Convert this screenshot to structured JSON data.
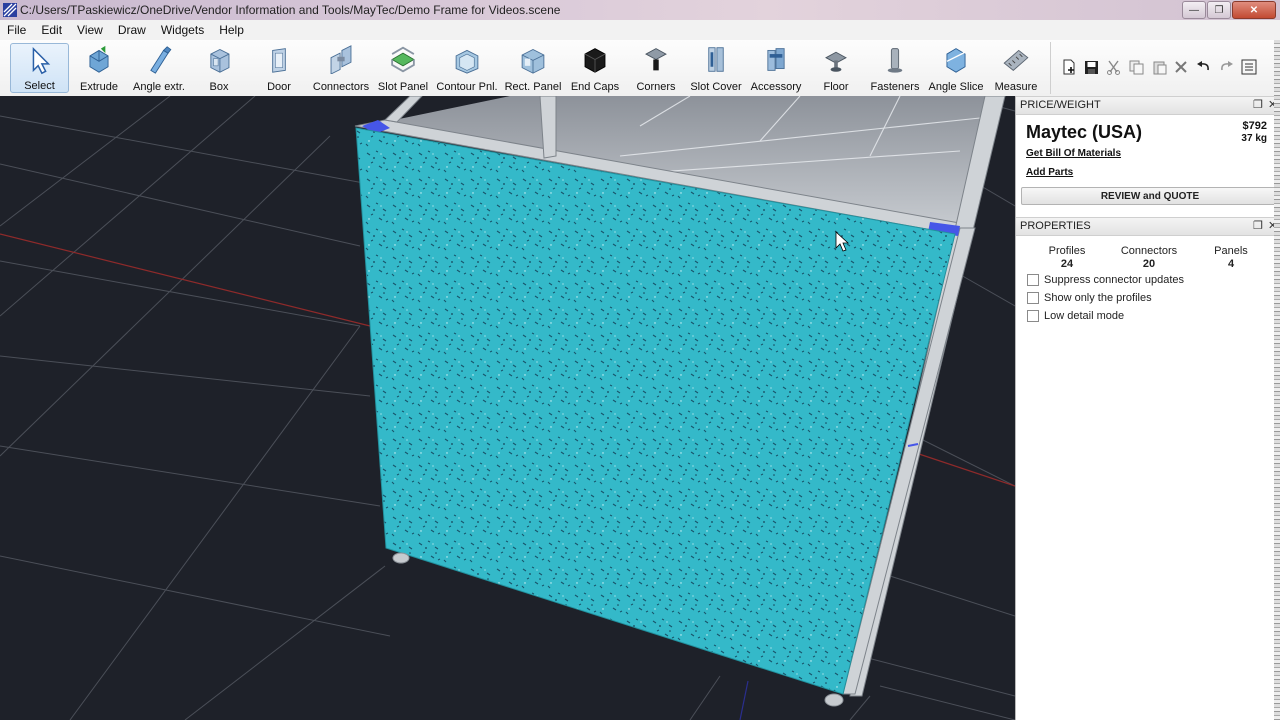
{
  "window": {
    "title": "C:/Users/TPaskiewicz/OneDrive/Vendor Information and Tools/MayTec/Demo Frame for Videos.scene",
    "controls": [
      "minimize",
      "restore",
      "close"
    ]
  },
  "menu": [
    "File",
    "Edit",
    "View",
    "Draw",
    "Widgets",
    "Help"
  ],
  "toolbar": {
    "tools": [
      {
        "label": "Select",
        "icon": "arrow-cursor-icon"
      },
      {
        "label": "Extrude",
        "icon": "extrude-icon"
      },
      {
        "label": "Angle extr.",
        "icon": "angle-extrude-icon"
      },
      {
        "label": "Box",
        "icon": "box-icon"
      },
      {
        "label": "Door",
        "icon": "door-icon"
      },
      {
        "label": "Connectors",
        "icon": "connectors-icon"
      },
      {
        "label": "Slot Panel",
        "icon": "slot-panel-icon"
      },
      {
        "label": "Contour Pnl.",
        "icon": "contour-panel-icon"
      },
      {
        "label": "Rect. Panel",
        "icon": "rect-panel-icon"
      },
      {
        "label": "End Caps",
        "icon": "end-caps-icon"
      },
      {
        "label": "Corners",
        "icon": "corners-icon"
      },
      {
        "label": "Slot Cover",
        "icon": "slot-cover-icon"
      },
      {
        "label": "Accessory",
        "icon": "accessory-icon"
      },
      {
        "label": "Floor",
        "icon": "floor-icon"
      },
      {
        "label": "Fasteners",
        "icon": "fasteners-icon"
      },
      {
        "label": "Angle Slice",
        "icon": "angle-slice-icon"
      },
      {
        "label": "Measure",
        "icon": "measure-icon"
      }
    ],
    "actions": [
      "new-file-icon",
      "save-icon",
      "cut-icon",
      "copy-icon",
      "paste-icon",
      "delete-icon",
      "undo-icon",
      "redo-icon",
      "options-icon"
    ],
    "active_tool": "Select"
  },
  "price_weight": {
    "header": "PRICE/WEIGHT",
    "company": "Maytec (USA)",
    "price": "$792",
    "weight": "37 kg",
    "bom_link": "Get Bill Of Materials",
    "add_parts_link": "Add Parts",
    "review_button": "REVIEW and QUOTE"
  },
  "properties": {
    "header": "PROPERTIES",
    "stats": [
      {
        "label": "Profiles",
        "value": "24"
      },
      {
        "label": "Connectors",
        "value": "20"
      },
      {
        "label": "Panels",
        "value": "4"
      }
    ],
    "options": [
      {
        "label": "Suppress connector updates",
        "checked": false
      },
      {
        "label": "Show only the profiles",
        "checked": false
      },
      {
        "label": "Low detail mode",
        "checked": false
      }
    ]
  },
  "colors": {
    "panel_cyan": "#2ab8c8",
    "viewport_bg": "#1e2129",
    "grid": "#4a4e58",
    "axis_red": "#9a2a2a",
    "frame_aluminium": "#c8ccd0"
  }
}
